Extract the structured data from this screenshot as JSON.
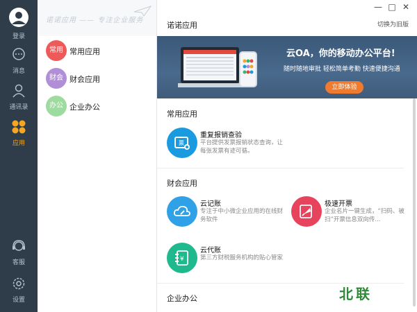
{
  "nav": {
    "items": [
      {
        "label": "登录",
        "icon": "avatar-icon"
      },
      {
        "label": "消息",
        "icon": "chat-icon"
      },
      {
        "label": "通讯录",
        "icon": "contacts-icon"
      },
      {
        "label": "应用",
        "icon": "apps-icon",
        "active": true
      },
      {
        "label": "客服",
        "icon": "headset-icon"
      },
      {
        "label": "设置",
        "icon": "gear-icon"
      }
    ]
  },
  "categories": {
    "slogan": "诺诺应用 —— 专注企业服务",
    "items": [
      {
        "badge": "常用",
        "label": "常用应用",
        "color": "#ee5a5a"
      },
      {
        "badge": "财会",
        "label": "财会应用",
        "color": "#b18fd6"
      },
      {
        "badge": "办公",
        "label": "企业办公",
        "color": "#9ddb9f"
      }
    ]
  },
  "window": {
    "minimize": "—",
    "maximize": "□",
    "close": "✕"
  },
  "main": {
    "title": "诺诺应用",
    "switch_label": "切换为旧版",
    "banner": {
      "title": "云OA，你的移动办公平台!",
      "subtitle": "随时随地审批 轻松简单考勤 快速便捷沟通",
      "button": "立即体验"
    },
    "sections": [
      {
        "title": "常用应用",
        "apps": [
          {
            "title": "重复报销查验",
            "desc": "平台提供发票报销状态查询，让每张发票有迹可循。",
            "color": "#1a9be0",
            "icon": "invoice-check-icon"
          }
        ]
      },
      {
        "title": "财会应用",
        "apps": [
          {
            "title": "云记账",
            "desc": "专注于中小微企业应用的在线财务软件",
            "color": "#2fa1e6",
            "icon": "cloud-ledger-icon"
          },
          {
            "title": "极速开票",
            "desc": "企业名片一键生成，“扫码、被扫”开票信息双向传...",
            "color": "#e8435c",
            "icon": "rocket-invoice-icon"
          },
          {
            "title": "云代账",
            "desc": "第三方财税服务机构的贴心管家",
            "color": "#20b98d",
            "icon": "ledger-book-icon"
          }
        ]
      },
      {
        "title": "企业办公",
        "apps": []
      }
    ]
  },
  "watermark": "北联"
}
